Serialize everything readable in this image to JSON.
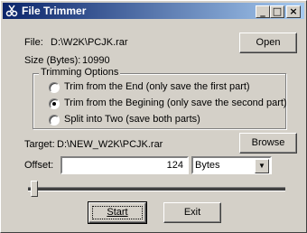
{
  "window": {
    "title": "File Trimmer",
    "icon": "scissors-app-icon",
    "controls": {
      "minimize": "_",
      "maximize": "□",
      "close": "×"
    }
  },
  "file": {
    "label": "File:",
    "value": "D:\\W2K\\PCJK.rar",
    "open_button": "Open"
  },
  "size": {
    "label": "Size (Bytes):",
    "value": "10990"
  },
  "trimming": {
    "legend": "Trimming Options",
    "options": [
      {
        "label": "Trim from the End (only save the first part)",
        "selected": false
      },
      {
        "label": "Trim from the Begining (only save the second part)",
        "selected": true
      },
      {
        "label": "Split into Two (save both parts)",
        "selected": false
      }
    ]
  },
  "target": {
    "label": "Target:",
    "value": "D:\\NEW_W2K\\PCJK.rar",
    "browse_button": "Browse"
  },
  "offset": {
    "label": "Offset:",
    "value": "124",
    "unit": "Bytes"
  },
  "slider": {
    "fraction": 0.011
  },
  "actions": {
    "start": "Start",
    "exit": "Exit"
  }
}
